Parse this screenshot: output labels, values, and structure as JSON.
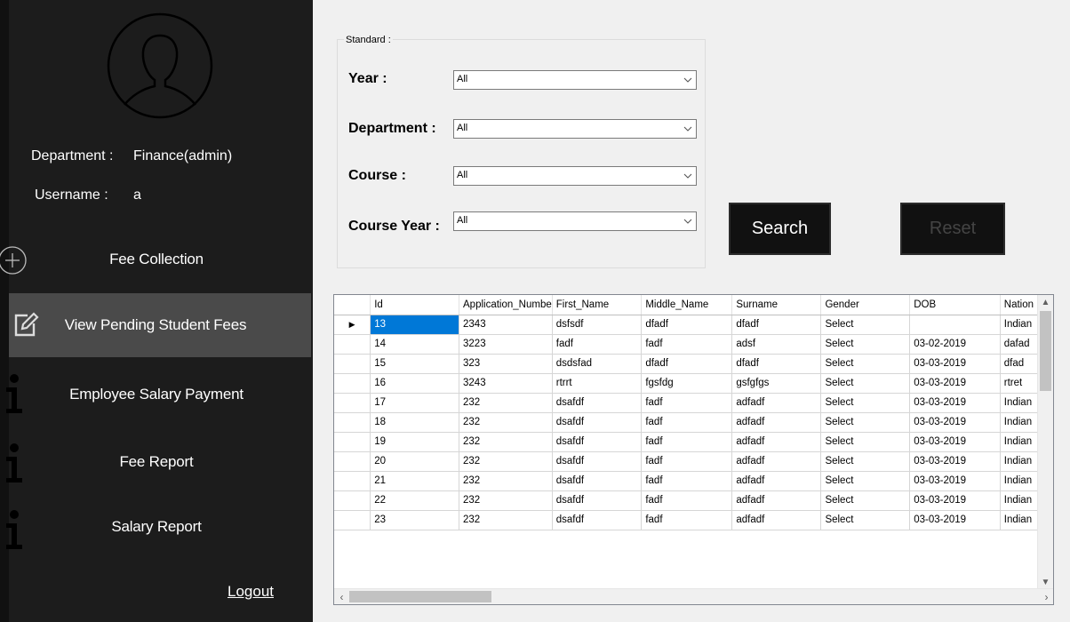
{
  "sidebar": {
    "department_label": "Department :",
    "department_value": "Finance(admin)",
    "username_label": "Username :",
    "username_value": "a",
    "nav": [
      {
        "label": "Fee Collection",
        "icon": "plus-circle-icon"
      },
      {
        "label": "View Pending Student Fees",
        "icon": "edit-icon",
        "active": true
      },
      {
        "label": "Employee Salary Payment",
        "icon": "info-icon"
      },
      {
        "label": "Fee Report",
        "icon": "info-icon"
      },
      {
        "label": "Salary Report",
        "icon": "info-icon"
      }
    ],
    "logout": "Logout"
  },
  "filters": {
    "group_title": "Standard :",
    "year_label": "Year :",
    "year_value": "All",
    "department_label": "Department :",
    "department_value": "All",
    "course_label": "Course :",
    "course_value": "All",
    "course_year_label": "Course Year :",
    "course_year_value": "All",
    "search_label": "Search",
    "reset_label": "Reset"
  },
  "grid": {
    "columns": [
      "Id",
      "Application_Numbe",
      "First_Name",
      "Middle_Name",
      "Surname",
      "Gender",
      "DOB",
      "Nation"
    ],
    "rows": [
      [
        "13",
        "2343",
        "dsfsdf",
        "dfadf",
        "dfadf",
        "Select",
        "",
        "Indian"
      ],
      [
        "14",
        "3223",
        "fadf",
        "fadf",
        "adsf",
        "Select",
        "03-02-2019",
        "dafad"
      ],
      [
        "15",
        "323",
        "dsdsfad",
        "dfadf",
        "dfadf",
        "Select",
        "03-03-2019",
        "dfad"
      ],
      [
        "16",
        "3243",
        "rtrrt",
        "fgsfdg",
        "gsfgfgs",
        "Select",
        "03-03-2019",
        "rtret"
      ],
      [
        "17",
        "232",
        "dsafdf",
        "fadf",
        "adfadf",
        "Select",
        "03-03-2019",
        "Indian"
      ],
      [
        "18",
        "232",
        "dsafdf",
        "fadf",
        "adfadf",
        "Select",
        "03-03-2019",
        "Indian"
      ],
      [
        "19",
        "232",
        "dsafdf",
        "fadf",
        "adfadf",
        "Select",
        "03-03-2019",
        "Indian"
      ],
      [
        "20",
        "232",
        "dsafdf",
        "fadf",
        "adfadf",
        "Select",
        "03-03-2019",
        "Indian"
      ],
      [
        "21",
        "232",
        "dsafdf",
        "fadf",
        "adfadf",
        "Select",
        "03-03-2019",
        "Indian"
      ],
      [
        "22",
        "232",
        "dsafdf",
        "fadf",
        "adfadf",
        "Select",
        "03-03-2019",
        "Indian"
      ],
      [
        "23",
        "232",
        "dsafdf",
        "fadf",
        "adfadf",
        "Select",
        "03-03-2019",
        "Indian"
      ]
    ],
    "selected_row": 0
  },
  "colors": {
    "sidebar_bg": "#1c1c1c",
    "active_nav_bg": "#4a4a4a",
    "selection": "#0078d7"
  }
}
